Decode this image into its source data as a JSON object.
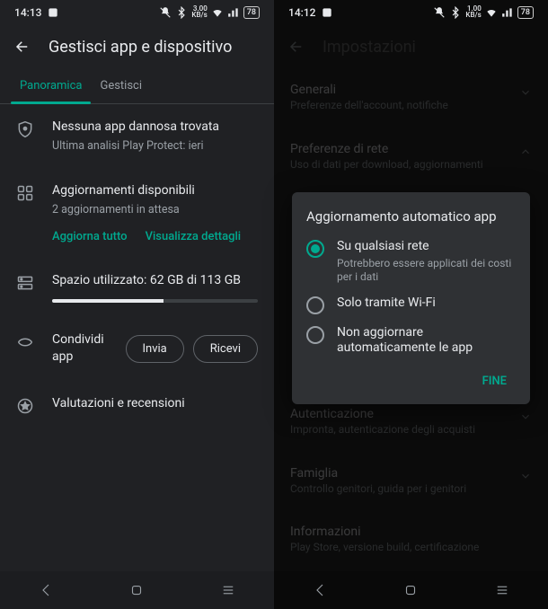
{
  "accent": "#00a98f",
  "left": {
    "status_time": "14:13",
    "net_label": "3.00",
    "net_unit": "KB/s",
    "battery": "78",
    "header_title": "Gestisci app e dispositivo",
    "tabs": [
      "Panoramica",
      "Gestisci"
    ],
    "protect": {
      "title": "Nessuna app dannosa trovata",
      "sub": "Ultima analisi Play Protect: ieri"
    },
    "updates": {
      "title": "Aggiornamenti disponibili",
      "sub": "2 aggiornamenti in attesa",
      "update_all": "Aggiorna tutto",
      "view_details": "Visualizza dettagli"
    },
    "storage": {
      "label": "Spazio utilizzato: 62 GB di 113 GB",
      "used": 62,
      "total": 113
    },
    "share": {
      "label": "Condividi app",
      "send": "Invia",
      "receive": "Ricevi"
    },
    "reviews": {
      "label": "Valutazioni e recensioni"
    }
  },
  "right": {
    "status_time": "14:12",
    "net_label": "1.00",
    "net_unit": "KB/s",
    "battery": "78",
    "header_title": "Impostazioni",
    "items": [
      {
        "title": "Generali",
        "sub": "Preferenze dell'account, notifiche"
      },
      {
        "title": "Preferenze di rete",
        "sub": "Uso di dati per download, aggiornamenti"
      },
      {
        "title": "Autenticazione",
        "sub": "Impronta, autenticazione degli acquisti"
      },
      {
        "title": "Famiglia",
        "sub": "Controllo genitori, guida per i genitori"
      },
      {
        "title": "Informazioni",
        "sub": "Play Store, versione build, certificazione"
      }
    ],
    "dialog": {
      "title": "Aggiornamento automatico app",
      "options": [
        {
          "label": "Su qualsiasi rete",
          "sub": "Potrebbero essere applicati dei costi per i dati",
          "selected": true
        },
        {
          "label": "Solo tramite Wi-Fi",
          "sub": ""
        },
        {
          "label": "Non aggiornare automaticamente le app",
          "sub": ""
        }
      ],
      "done": "FINE"
    }
  }
}
